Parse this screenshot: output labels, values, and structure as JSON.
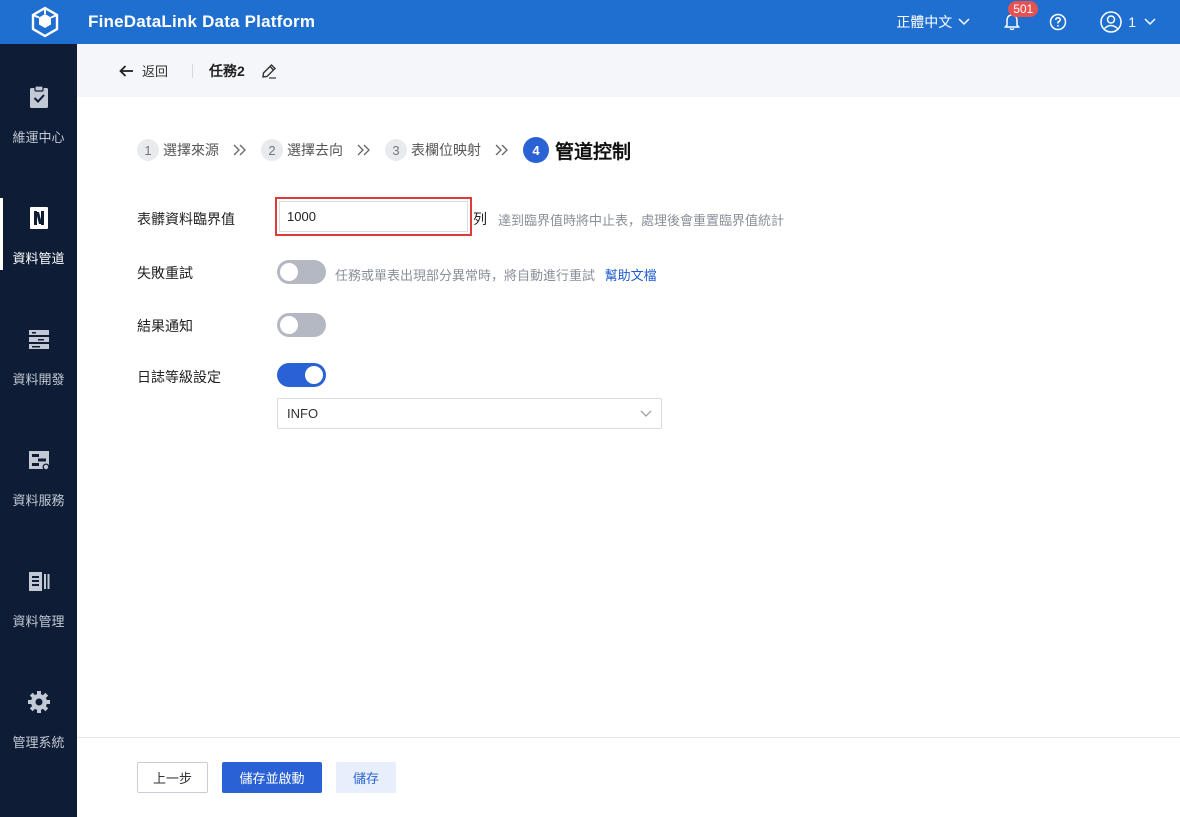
{
  "app": {
    "title": "FineDataLink Data Platform",
    "brand_color": "#1f6fd1"
  },
  "topbar": {
    "language": "正體中文",
    "notification_count": "501",
    "user_name": "1"
  },
  "sidebar": {
    "items": [
      {
        "label": "維運中心",
        "icon": "clipboard-check-icon",
        "active": false
      },
      {
        "label": "資料管道",
        "icon": "pipeline-icon",
        "active": true
      },
      {
        "label": "資料開發",
        "icon": "dev-stack-icon",
        "active": false
      },
      {
        "label": "資料服務",
        "icon": "service-icon",
        "active": false
      },
      {
        "label": "資料管理",
        "icon": "data-manage-icon",
        "active": false
      },
      {
        "label": "管理系統",
        "icon": "gear-icon",
        "active": false
      }
    ]
  },
  "header": {
    "back_label": "返回",
    "task_name": "任務2"
  },
  "steps": [
    {
      "num": "1",
      "label": "選擇來源"
    },
    {
      "num": "2",
      "label": "選擇去向"
    },
    {
      "num": "3",
      "label": "表欄位映射"
    },
    {
      "num": "4",
      "label": "管道控制"
    }
  ],
  "form": {
    "threshold": {
      "label": "表髒資料臨界值",
      "value": "1000",
      "unit": "列",
      "hint": "達到臨界值時將中止表，處理後會重置臨界值統計"
    },
    "retry": {
      "label": "失敗重試",
      "enabled": false,
      "hint": "任務或單表出現部分異常時，將自動進行重試",
      "help_link": "幫助文檔"
    },
    "notify": {
      "label": "結果通知",
      "enabled": false
    },
    "log_level": {
      "label": "日誌等級設定",
      "enabled": true,
      "selected": "INFO"
    }
  },
  "footer": {
    "prev_label": "上一步",
    "save_start_label": "儲存並啟動",
    "save_label": "儲存"
  }
}
